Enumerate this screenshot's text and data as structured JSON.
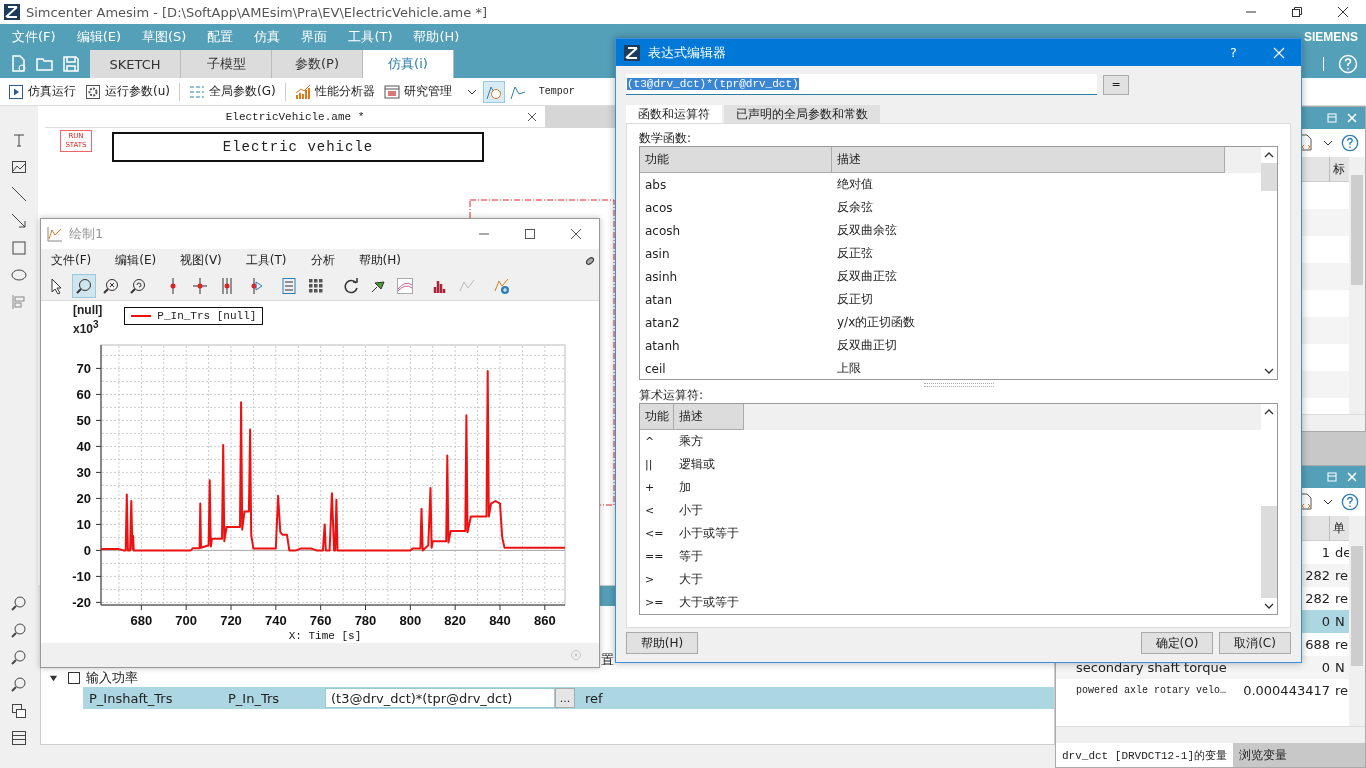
{
  "app": {
    "title": "Simcenter Amesim - [D:\\SoftApp\\AMEsim\\Pra\\EV\\ElectricVehicle.ame *]",
    "menu": [
      "文件(F)",
      "编辑(E)",
      "草图(S)",
      "配置",
      "仿真",
      "界面",
      "工具(T)",
      "帮助(H)"
    ],
    "brand": "SIEMENS"
  },
  "ribbon_tabs": [
    {
      "label": "SKETCH",
      "selected": false
    },
    {
      "label": "子模型",
      "selected": false
    },
    {
      "label": "参数(P)",
      "selected": false
    },
    {
      "label": "仿真(i)",
      "selected": true
    }
  ],
  "toolbar": {
    "items": [
      "仿真运行",
      "运行参数(u)",
      "全局参数(G)",
      "性能分析器",
      "研究管理"
    ],
    "view_toggles": [
      {
        "selected": true
      },
      {
        "selected": false
      }
    ],
    "cut_label": "Tempor"
  },
  "canvas": {
    "tab_title": "ElectricVehicle.ame *",
    "run_stats": [
      "RUN",
      "STATS"
    ],
    "title_box": "Electric vehicle"
  },
  "params": {
    "partial_label": "置",
    "group": {
      "label": "输入功率",
      "expanded": true,
      "checked": false
    },
    "rows": [
      {
        "name": "P_Inshaft_Trs",
        "title": "P_In_Trs",
        "value": "(t3@drv_dct)*(tpr@drv_dct)",
        "button": "...",
        "unit": "ref",
        "selected": true
      }
    ]
  },
  "plot_window": {
    "title": "绘制1",
    "menu": [
      "文件(F)",
      "编辑(E)",
      "视图(V)",
      "工具(T)",
      "分析",
      "帮助(H)"
    ],
    "tools": [
      {
        "selected": false
      },
      {
        "selected": true
      },
      {
        "selected": false
      },
      {
        "selected": false
      },
      {
        "selected": false
      },
      {
        "selected": false
      },
      {
        "selected": false
      },
      {
        "selected": false
      },
      {
        "selected": false
      },
      {
        "selected": false
      },
      {
        "selected": false
      },
      {
        "selected": false
      },
      {
        "selected": false
      },
      {
        "selected": false
      },
      {
        "selected": false
      },
      {
        "selected": false
      }
    ],
    "y_scale": "x10$^{3}$",
    "chart_data": {
      "type": "line",
      "grid": true,
      "xlabel": "X: Time [s]",
      "ylabel": "[null]",
      "xlim": [
        662,
        869
      ],
      "ylim": [
        -21,
        79
      ],
      "xticks": [
        680,
        700,
        720,
        740,
        760,
        780,
        800,
        820,
        840,
        860
      ],
      "yticks": [
        -20,
        -10,
        0,
        10,
        20,
        30,
        40,
        50,
        60,
        70
      ],
      "x": [
        662,
        670,
        672,
        673,
        673.5,
        674,
        675,
        675.5,
        676,
        676.3,
        676.6,
        702,
        703,
        706,
        706.3,
        706.6,
        710,
        710.5,
        711,
        711.5,
        716,
        716.5,
        717,
        718,
        724,
        724.5,
        725,
        726,
        728,
        728.5,
        729,
        730,
        740,
        741,
        742,
        743,
        745,
        746,
        749,
        751,
        756,
        758,
        761,
        761.8,
        762.3,
        764,
        765,
        766,
        766.5,
        767,
        767.5,
        800,
        801,
        804.5,
        805,
        805.5,
        808,
        809,
        809.5,
        810,
        816,
        816.5,
        817,
        818,
        824.5,
        825,
        825.5,
        827,
        834,
        834.5,
        835,
        836,
        838,
        840,
        841,
        842,
        869
      ],
      "series": [
        {
          "name": "P_In_Trs [null]",
          "color": "#ee1111",
          "values": [
            0.5,
            0.5,
            0,
            0,
            21.5,
            0,
            0,
            19,
            0.5,
            5.5,
            0,
            0,
            0.8,
            0.8,
            18,
            1,
            2,
            27,
            1.5,
            4.5,
            4.5,
            40.5,
            3.5,
            9,
            9,
            57,
            8,
            15,
            15,
            46.5,
            6,
            0.7,
            0.7,
            21,
            7,
            6,
            6,
            0,
            0,
            0.7,
            0.7,
            0,
            0,
            10,
            0,
            0,
            22,
            0,
            0,
            19.5,
            0,
            0,
            0.7,
            0.7,
            16,
            0,
            2,
            24,
            1,
            3.5,
            3.5,
            36.5,
            3,
            7.5,
            7.5,
            52,
            7,
            13,
            13,
            69,
            13,
            18,
            19,
            18,
            5,
            1,
            1
          ]
        }
      ]
    }
  },
  "dialog": {
    "title": "表达式编辑器",
    "help_glyph": "?",
    "expression": "(t3@drv_dct)*(tpr@drv_dct)",
    "equals": "=",
    "tabs": [
      {
        "label": "函数和运算符",
        "selected": true
      },
      {
        "label": "已声明的全局参数和常数",
        "selected": false
      }
    ],
    "functions": {
      "label": "数学函数:",
      "columns": [
        "功能",
        "描述"
      ],
      "rows": [
        {
          "name": "abs",
          "description": "绝对值"
        },
        {
          "name": "acos",
          "description": "反余弦"
        },
        {
          "name": "acosh",
          "description": "反双曲余弦"
        },
        {
          "name": "asin",
          "description": "反正弦"
        },
        {
          "name": "asinh",
          "description": "反双曲正弦"
        },
        {
          "name": "atan",
          "description": "反正切"
        },
        {
          "name": "atan2",
          "description": " y/x的正切函数"
        },
        {
          "name": "atanh",
          "description": "反双曲正切"
        },
        {
          "name": "ceil",
          "description": "上限"
        }
      ]
    },
    "operators": {
      "label": "算术运算符:",
      "columns": [
        "功能",
        "描述"
      ],
      "rows": [
        {
          "name": "^",
          "description": "乘方"
        },
        {
          "name": "||",
          "description": "逻辑或"
        },
        {
          "name": "+",
          "description": "加"
        },
        {
          "name": "<",
          "description": "小于"
        },
        {
          "name": "<=",
          "description": "小于或等于"
        },
        {
          "name": "==",
          "description": "等于"
        },
        {
          "name": ">",
          "description": "大于"
        },
        {
          "name": ">=",
          "description": "大于或等于"
        }
      ]
    },
    "buttons": {
      "help": "帮助(H)",
      "ok": "确定(O)",
      "cancel": "取消(C)"
    }
  },
  "top_panel": {
    "column_header": "标"
  },
  "variables_panel": {
    "column_header": "单",
    "rows": [
      {
        "value": "1",
        "unit": "de",
        "selected": false
      },
      {
        "value": "282",
        "unit": "re",
        "selected": false
      },
      {
        "value": "282",
        "unit": "re",
        "selected": false
      },
      {
        "value": "0",
        "unit": "N",
        "selected": true
      },
      {
        "value": "688",
        "unit": "re",
        "selected": false
      },
      {
        "name": "secondary shaft torque",
        "value": "0",
        "unit": "N",
        "selected": false
      },
      {
        "name": "powered axle rotary velo…",
        "value": "0.000443417",
        "unit": "re",
        "selected": false
      }
    ],
    "tabs": [
      {
        "label": "drv_dct [DRVDCT12-1]的变量",
        "selected": true
      },
      {
        "label": "浏览变量",
        "selected": false
      }
    ]
  }
}
